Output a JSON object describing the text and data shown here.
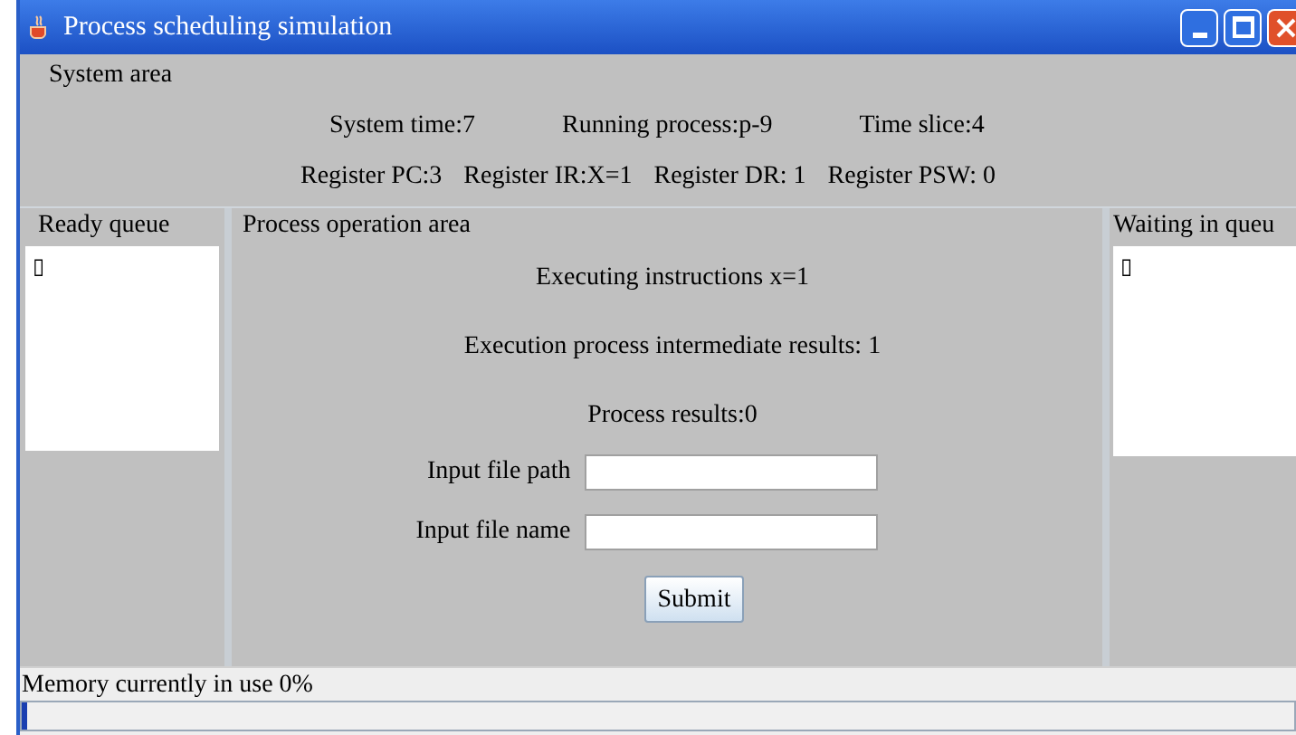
{
  "window": {
    "title": "Process scheduling simulation"
  },
  "system_area": {
    "title": "System area",
    "row_1": [
      "System time:7",
      "Running process:p-9",
      "Time slice:4"
    ],
    "row_2": [
      "Register PC:3",
      "Register IR:X=1",
      "Register DR: 1",
      "Register PSW: 0"
    ]
  },
  "ready_queue": {
    "title": "Ready queue",
    "items": [
      "▯"
    ]
  },
  "operation_area": {
    "title": "Process operation area",
    "lines": [
      "Executing instructions x=1",
      "Execution process intermediate results: 1",
      "Process results:0"
    ],
    "fields": [
      {
        "label": "Input file path"
      },
      {
        "label": "Input file name"
      }
    ],
    "submit": "Submit"
  },
  "waiting_queue": {
    "title": "Waiting in queu",
    "items": [
      "▯"
    ]
  },
  "status": {
    "text": "Memory currently in use 0%",
    "level": 0
  }
}
